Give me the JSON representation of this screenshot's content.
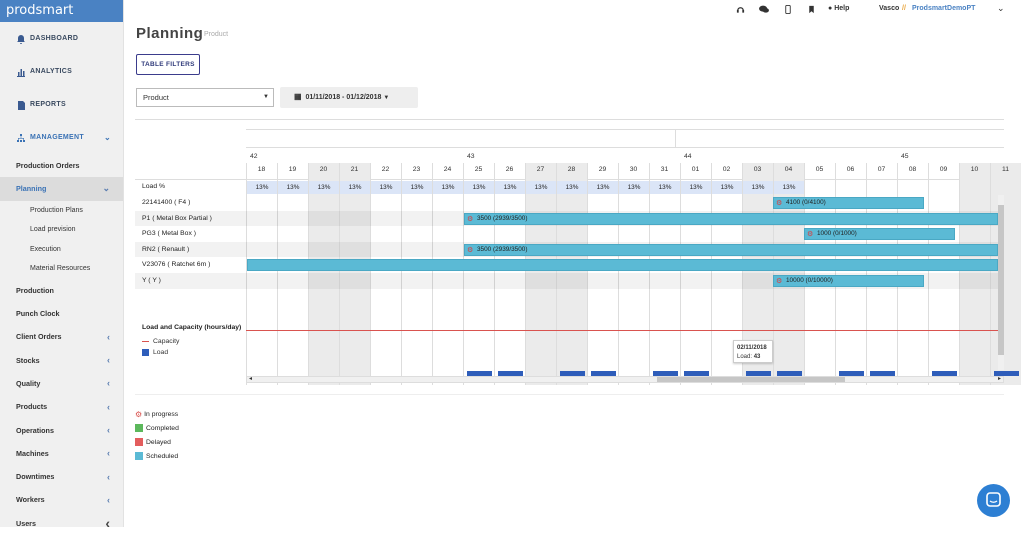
{
  "app": {
    "logo": "prodsmart"
  },
  "sidebar": {
    "main": [
      {
        "label": "DASHBOARD",
        "icon": "bell-icon"
      },
      {
        "label": "ANALYTICS",
        "icon": "bar-chart-icon"
      },
      {
        "label": "REPORTS",
        "icon": "document-icon"
      },
      {
        "label": "MANAGEMENT",
        "icon": "sitemap-icon"
      }
    ],
    "items": [
      {
        "label": "Production Orders"
      },
      {
        "label": "Planning"
      }
    ],
    "planning_sub": [
      {
        "label": "Production Plans"
      },
      {
        "label": "Load prevision"
      },
      {
        "label": "Execution"
      },
      {
        "label": "Material Resources"
      }
    ],
    "items2": [
      "Production",
      "Punch Clock",
      "Client Orders",
      "Stocks",
      "Quality",
      "Products",
      "Operations",
      "Machines",
      "Downtimes",
      "Workers",
      "Users"
    ]
  },
  "topbar": {
    "help": "Help",
    "user": "Vasco",
    "separator": "//",
    "company": "ProdsmartDemoPT"
  },
  "page": {
    "title": "Planning",
    "subtitle": "Product",
    "filters_button": "TABLE FILTERS",
    "select_value": "Product",
    "date_range": "01/11/2018 - 01/12/2018"
  },
  "gantt": {
    "weeks": [
      {
        "label": "42"
      },
      {
        "label": "43"
      },
      {
        "label": "44"
      },
      {
        "label": "45"
      }
    ],
    "days": [
      "18",
      "19",
      "20",
      "21",
      "22",
      "23",
      "24",
      "25",
      "26",
      "27",
      "28",
      "29",
      "30",
      "31",
      "01",
      "02",
      "03",
      "04",
      "05",
      "06",
      "07",
      "08",
      "09",
      "10",
      "11"
    ],
    "gray_days": [
      "20",
      "21",
      "27",
      "28",
      "03",
      "04",
      "10",
      "11"
    ],
    "load_label": "Load %",
    "load_values": [
      "13%",
      "13%",
      "13%",
      "13%",
      "13%",
      "13%",
      "13%",
      "13%",
      "13%",
      "13%",
      "13%",
      "13%",
      "13%",
      "13%",
      "13%",
      "13%",
      "13%",
      "13%"
    ],
    "rows": [
      {
        "label": "22141400 ( F4 )",
        "bar": "4100 (0/4100)",
        "start_day": "04",
        "end_day": "08",
        "icon": true
      },
      {
        "label": "P1 ( Metal Box Partial )",
        "bar": "3500 (2939/3500)",
        "start_day": "25",
        "end_day": "11",
        "icon": true
      },
      {
        "label": "PG3 ( Metal Box )",
        "bar": "1000 (0/1000)",
        "start_day": "05",
        "end_day": "09",
        "icon": true
      },
      {
        "label": "RN2 ( Renault )",
        "bar": "3500 (2939/3500)",
        "start_day": "25",
        "end_day": "11",
        "icon": true
      },
      {
        "label": "V23076 ( Ratchet 6m )",
        "bar": "",
        "start_day": "18",
        "end_day": "11",
        "icon": false
      },
      {
        "label": "Y ( Y )",
        "bar": "10000 (0/10000)",
        "start_day": "04",
        "end_day": "08",
        "icon": true
      }
    ],
    "capacity_title": "Load and Capacity (hours/day)",
    "capacity_legend": "Capacity",
    "load_legend": "Load",
    "load_bar_days": [
      "25",
      "26",
      "28",
      "29",
      "31",
      "01",
      "03",
      "04",
      "06",
      "07",
      "09",
      "11"
    ],
    "tooltip": {
      "date": "02/11/2018",
      "label": "Load:",
      "value": "43"
    }
  },
  "legend": [
    {
      "label": "In progress",
      "color": "#d9534f",
      "icon": "gears-icon"
    },
    {
      "label": "Completed",
      "color": "#5cb85c"
    },
    {
      "label": "Delayed",
      "color": "#e35d5d"
    },
    {
      "label": "Scheduled",
      "color": "#5bbad5"
    }
  ],
  "colors": {
    "accent": "#4a82c3",
    "bar": "#5bbad5",
    "load": "#2e5dba",
    "capacity": "#d9534f"
  }
}
